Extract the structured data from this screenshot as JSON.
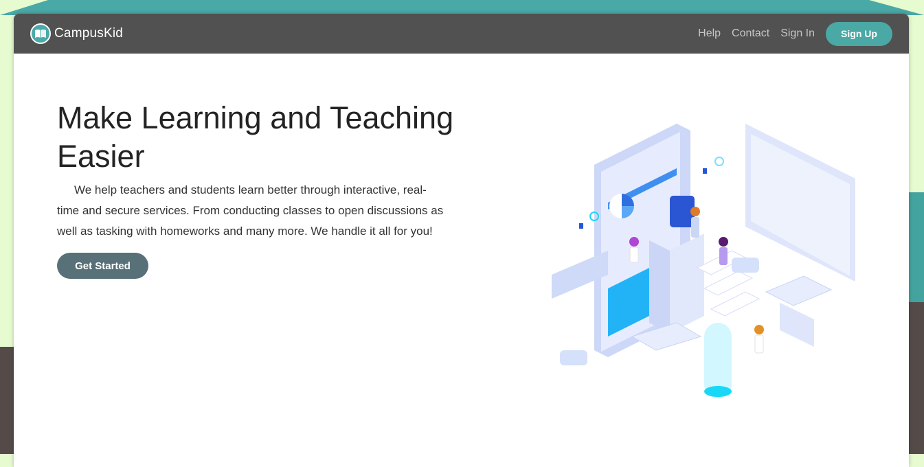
{
  "brand": {
    "name": "CampusKid",
    "logo_icon": "book-icon"
  },
  "nav": {
    "links": [
      "Help",
      "Contact",
      "Sign In"
    ],
    "signup_label": "Sign Up"
  },
  "hero": {
    "title": "Make Learning and Teaching Easier",
    "description": "We help teachers and students learn better through interactive, real-time and secure services. From conducting classes to open discussions as well as tasking with homeworks and many more. We handle it all for you!",
    "cta_label": "Get Started",
    "illustration_icon": "isometric-classroom-illustration"
  },
  "colors": {
    "navbar": "#515151",
    "accent_teal": "#4aa9a4",
    "cta": "#587078",
    "background_green": "#e6fbcf"
  }
}
